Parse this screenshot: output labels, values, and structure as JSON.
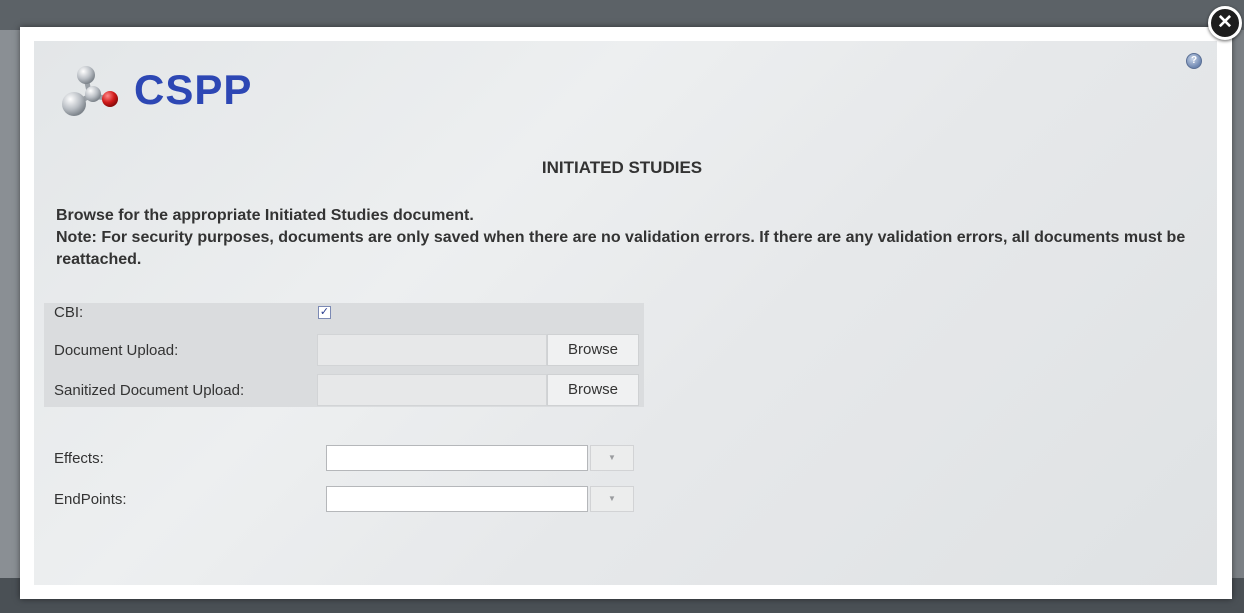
{
  "app": {
    "logo_text": "CSPP"
  },
  "dialog": {
    "title": "INITIATED STUDIES",
    "close_icon": "close-icon",
    "help_icon": "help-icon",
    "instructions": [
      "Browse for the appropriate Initiated Studies document.",
      "Note: For security purposes, documents are only saved when there are no validation errors. If there are any validation errors, all documents must be reattached."
    ]
  },
  "form": {
    "cbi_label": "CBI:",
    "cbi_checked": true,
    "document_upload_label": "Document Upload:",
    "document_upload_value": "",
    "sanitized_upload_label": "Sanitized Document Upload:",
    "sanitized_upload_value": "",
    "browse_label": "Browse",
    "effects_label": "Effects:",
    "effects_value": "",
    "endpoints_label": "EndPoints:",
    "endpoints_value": ""
  },
  "colors": {
    "logo_blue": "#2d47b4",
    "logo_red": "#c8102e"
  }
}
